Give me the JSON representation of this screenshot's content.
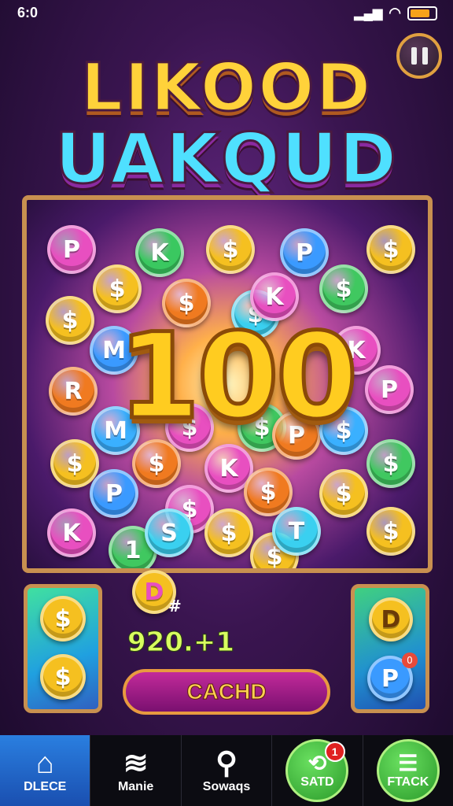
{
  "status": {
    "time": "6:0",
    "battery_icon": "battery-icon",
    "wifi_icon": "wifi-icon",
    "signal_icon": "signal-icon"
  },
  "title": {
    "line1": "LIKOOD",
    "line2": "UAKQUD"
  },
  "board": {
    "big_number": "100",
    "coins": [
      {
        "label": "P",
        "color": "#e84fc0"
      },
      {
        "label": "K",
        "color": "#3ac860"
      },
      {
        "label": "$",
        "color": "#f5c020"
      },
      {
        "label": "P",
        "color": "#3a9aff"
      },
      {
        "label": "$",
        "color": "#f5c020"
      },
      {
        "label": "$",
        "color": "#f5c020"
      },
      {
        "label": "$",
        "color": "#f07a20"
      },
      {
        "label": "$",
        "color": "#3ad0f0"
      },
      {
        "label": "K",
        "color": "#e84fc0"
      },
      {
        "label": "$",
        "color": "#40c860"
      },
      {
        "label": "$",
        "color": "#f5c020"
      },
      {
        "label": "M",
        "color": "#3a9aff"
      },
      {
        "label": "K",
        "color": "#e84fc0"
      },
      {
        "label": "R",
        "color": "#f07a20"
      },
      {
        "label": "P",
        "color": "#e84fc0"
      },
      {
        "label": "M",
        "color": "#3ab0ff"
      },
      {
        "label": "$",
        "color": "#e84fc0"
      },
      {
        "label": "$",
        "color": "#40c860"
      },
      {
        "label": "P",
        "color": "#f07a20"
      },
      {
        "label": "$",
        "color": "#3ab0ff"
      },
      {
        "label": "$",
        "color": "#f5c020"
      },
      {
        "label": "$",
        "color": "#f07a20"
      },
      {
        "label": "K",
        "color": "#e84fc0"
      },
      {
        "label": "$",
        "color": "#f07a20"
      },
      {
        "label": "$",
        "color": "#40c860"
      },
      {
        "label": "P",
        "color": "#3a9aff"
      },
      {
        "label": "$",
        "color": "#e84fc0"
      },
      {
        "label": "$",
        "color": "#f5c020"
      },
      {
        "label": "$",
        "color": "#f5c020"
      },
      {
        "label": "K",
        "color": "#e84fc0"
      },
      {
        "label": "1",
        "color": "#40c860"
      },
      {
        "label": "S",
        "color": "#3ad0f0"
      },
      {
        "label": "$",
        "color": "#f5c020"
      },
      {
        "label": "T",
        "color": "#3ad0f0"
      },
      {
        "label": "$",
        "color": "#f5c020"
      }
    ]
  },
  "left_panel": {
    "coin_top": "$",
    "coin_bottom": "$"
  },
  "right_panel": {
    "coin_top": "D",
    "coin_bottom": "P",
    "badge": "0"
  },
  "floating_coin": {
    "label": "D",
    "tag": "#"
  },
  "score": "920.+1",
  "cash_button": "CACHD",
  "nav": [
    {
      "label": "DLECE",
      "icon": "home-icon",
      "glyph": "⌂",
      "active": true
    },
    {
      "label": "Manie",
      "icon": "zigzag-icon",
      "glyph": "≋",
      "active": false
    },
    {
      "label": "Sowaqs",
      "icon": "search-icon",
      "glyph": "⚲",
      "active": false
    },
    {
      "label": "SATD",
      "icon": "refresh-icon",
      "glyph": "⟲",
      "badge": "1",
      "active": false
    },
    {
      "label": "FTACK",
      "icon": "stack-icon",
      "glyph": "☰",
      "active": false
    }
  ]
}
